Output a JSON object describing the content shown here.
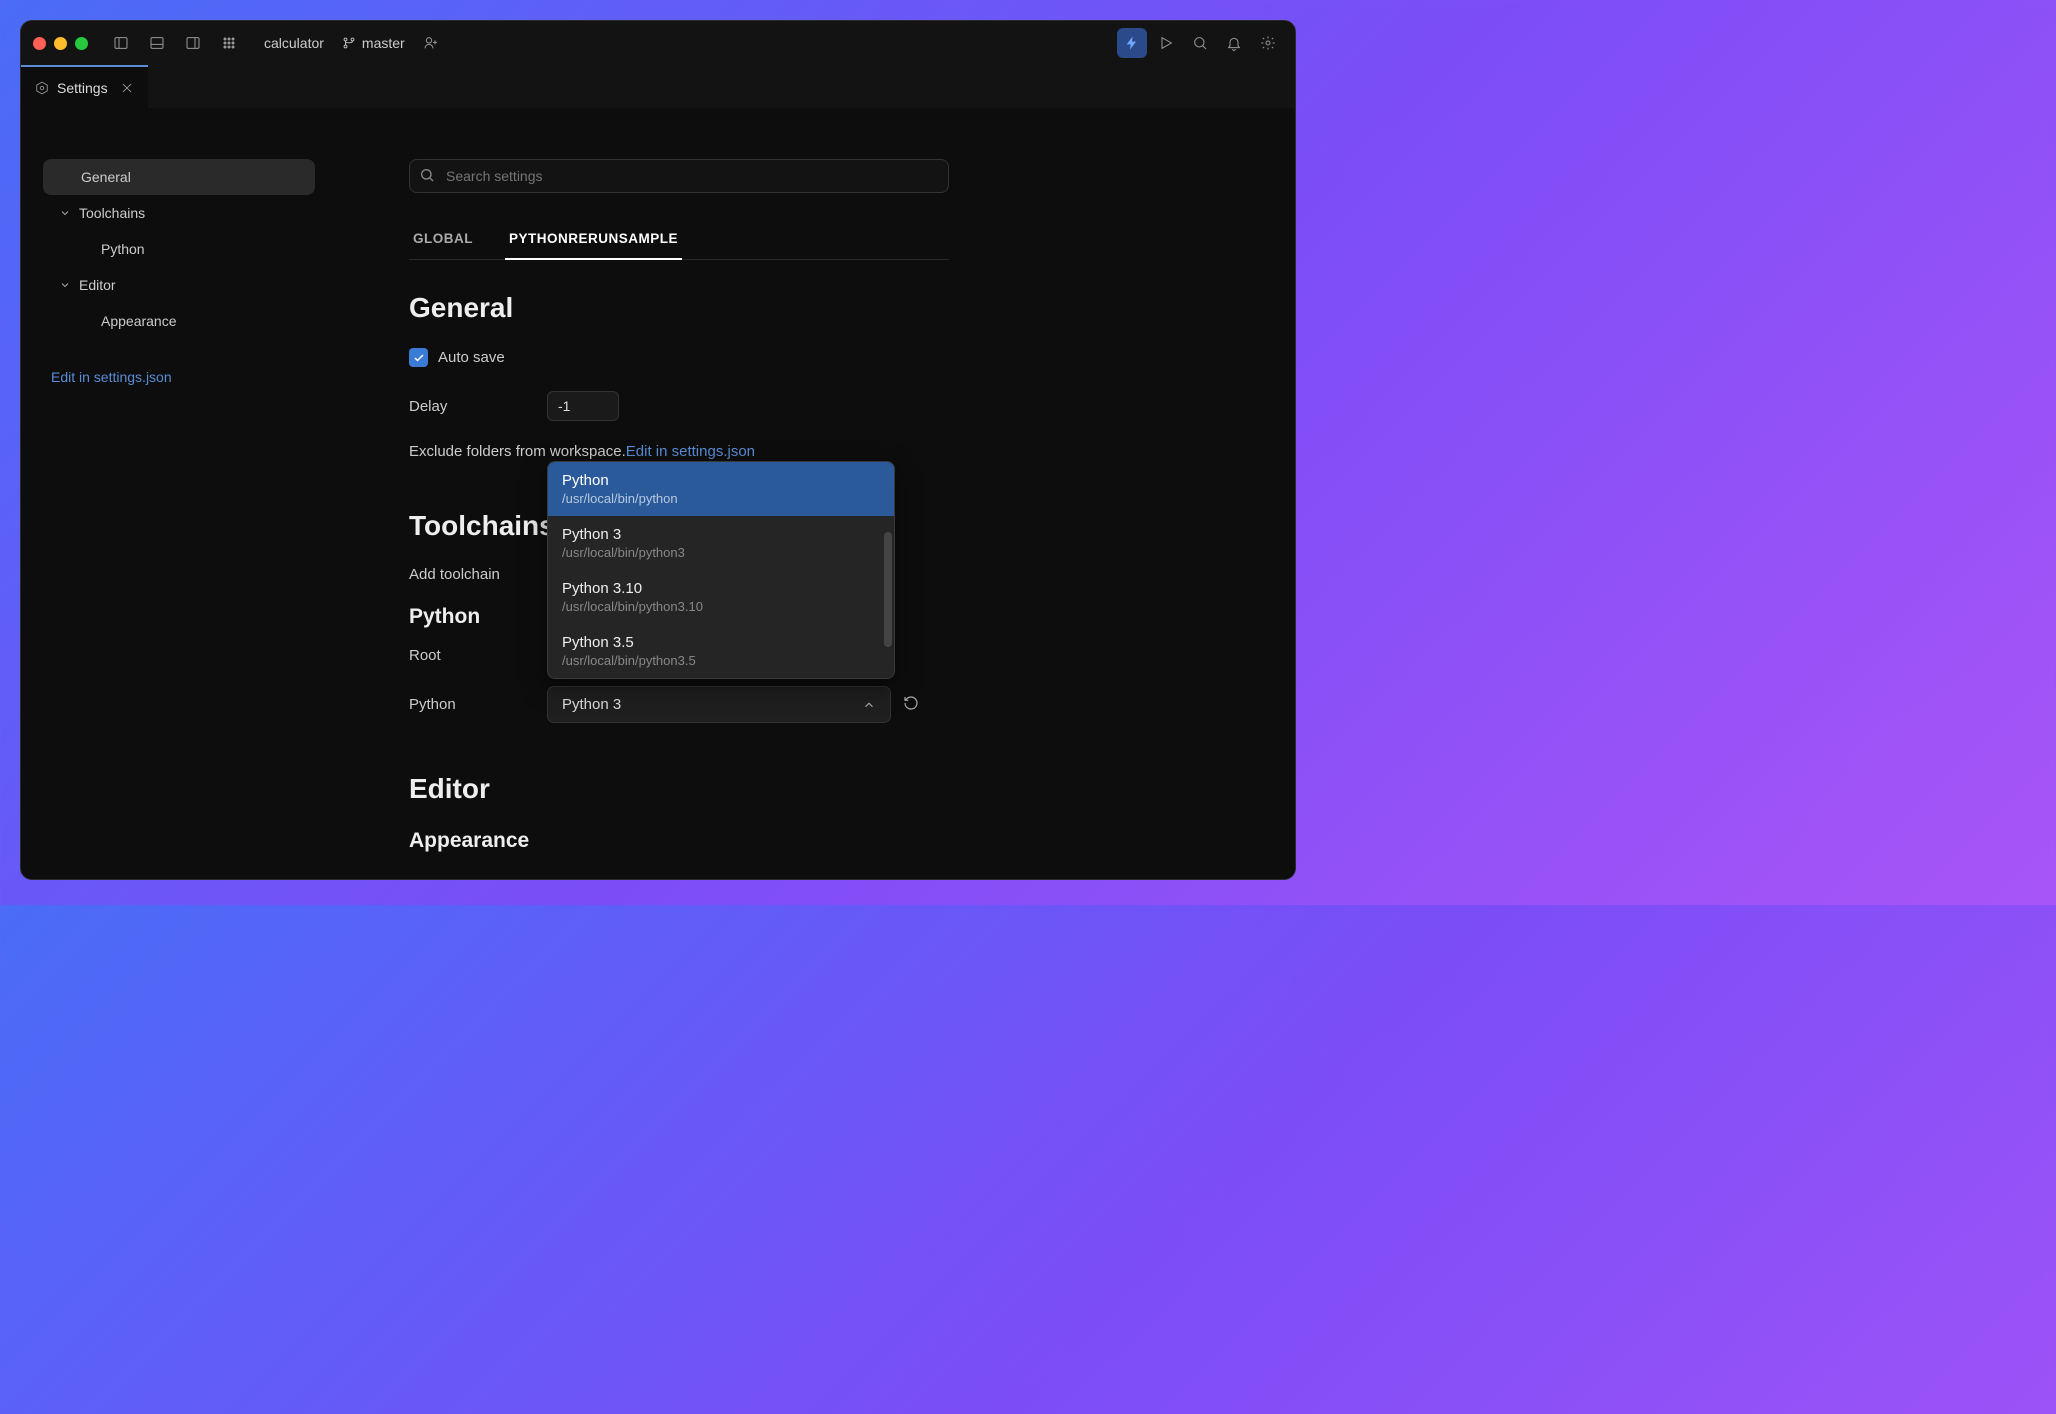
{
  "titlebar": {
    "project": "calculator",
    "branch": "master"
  },
  "tab": {
    "title": "Settings"
  },
  "sidebar": {
    "items": [
      {
        "label": "General"
      },
      {
        "label": "Toolchains"
      },
      {
        "label": "Python"
      },
      {
        "label": "Editor"
      },
      {
        "label": "Appearance"
      }
    ],
    "edit_link": "Edit in settings.json"
  },
  "search": {
    "placeholder": "Search settings"
  },
  "scope_tabs": {
    "global": "GLOBAL",
    "project": "PYTHONRERUNSAMPLE"
  },
  "sections": {
    "general": {
      "title": "General",
      "auto_save_label": "Auto save",
      "delay_label": "Delay",
      "delay_value": "-1",
      "exclude_label": "Exclude folders from workspace. ",
      "exclude_link": "Edit in settings.json"
    },
    "toolchains": {
      "title": "Toolchains",
      "add_label": "Add toolchain",
      "python_title": "Python",
      "root_label": "Root",
      "python_label": "Python",
      "python_value": "Python 3"
    },
    "editor": {
      "title": "Editor",
      "appearance_title": "Appearance"
    }
  },
  "dropdown": {
    "options": [
      {
        "name": "Python",
        "path": "/usr/local/bin/python"
      },
      {
        "name": "Python 3",
        "path": "/usr/local/bin/python3"
      },
      {
        "name": "Python 3.10",
        "path": "/usr/local/bin/python3.10"
      },
      {
        "name": "Python 3.5",
        "path": "/usr/local/bin/python3.5"
      }
    ]
  }
}
